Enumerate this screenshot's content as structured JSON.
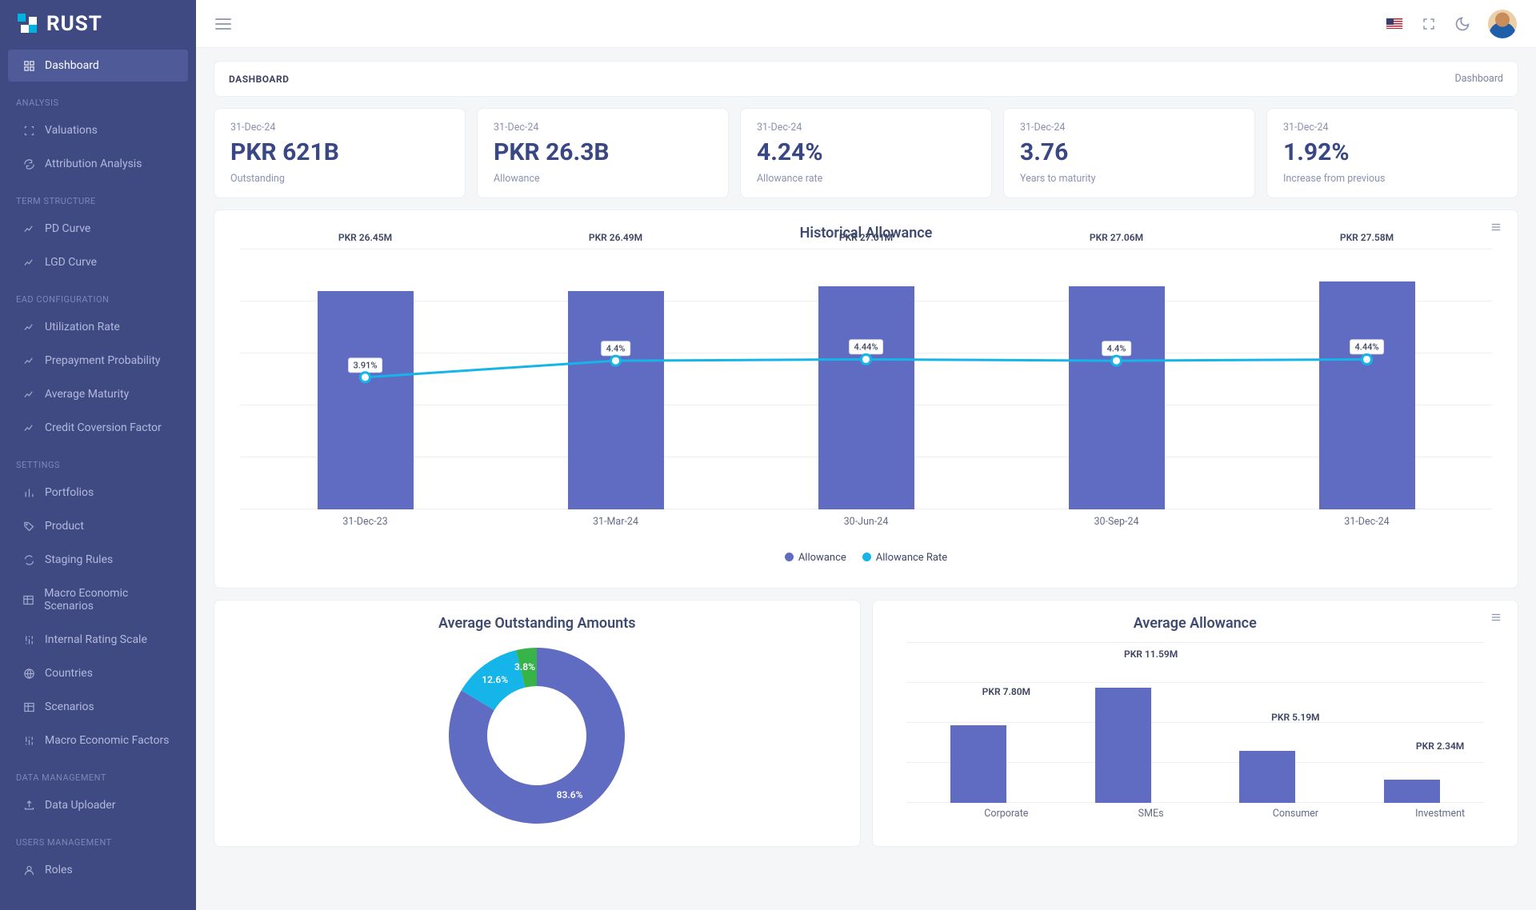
{
  "brand": "RUST",
  "sidebar": {
    "items": [
      {
        "label": "Dashboard",
        "icon": "grid",
        "active": true
      },
      {
        "heading": "ANALYSIS"
      },
      {
        "label": "Valuations",
        "icon": "scan"
      },
      {
        "label": "Attribution Analysis",
        "icon": "refresh"
      },
      {
        "heading": "TERM STRUCTURE"
      },
      {
        "label": "PD Curve",
        "icon": "line-chart"
      },
      {
        "label": "LGD Curve",
        "icon": "line-chart"
      },
      {
        "heading": "EAD CONFIGURATION"
      },
      {
        "label": "Utilization Rate",
        "icon": "line-chart"
      },
      {
        "label": "Prepayment Probability",
        "icon": "line-chart"
      },
      {
        "label": "Average Maturity",
        "icon": "line-chart"
      },
      {
        "label": "Credit Coversion Factor",
        "icon": "line-chart"
      },
      {
        "heading": "SETTINGS"
      },
      {
        "label": "Portfolios",
        "icon": "bars"
      },
      {
        "label": "Product",
        "icon": "tag"
      },
      {
        "label": "Staging Rules",
        "icon": "cycle"
      },
      {
        "label": "Macro Economic Scenarios",
        "icon": "table"
      },
      {
        "label": "Internal Rating Scale",
        "icon": "sliders"
      },
      {
        "label": "Countries",
        "icon": "globe"
      },
      {
        "label": "Scenarios",
        "icon": "table"
      },
      {
        "label": "Macro Economic Factors",
        "icon": "sliders"
      },
      {
        "heading": "DATA MANAGEMENT"
      },
      {
        "label": "Data Uploader",
        "icon": "upload"
      },
      {
        "heading": "USERS MANAGEMENT"
      },
      {
        "label": "Roles",
        "icon": "user"
      }
    ]
  },
  "page": {
    "title": "DASHBOARD",
    "breadcrumb": "Dashboard"
  },
  "cards": [
    {
      "date": "31-Dec-24",
      "value": "PKR 621B",
      "label": "Outstanding"
    },
    {
      "date": "31-Dec-24",
      "value": "PKR 26.3B",
      "label": "Allowance"
    },
    {
      "date": "31-Dec-24",
      "value": "4.24%",
      "label": "Allowance rate"
    },
    {
      "date": "31-Dec-24",
      "value": "3.76",
      "label": "Years to maturity"
    },
    {
      "date": "31-Dec-24",
      "value": "1.92%",
      "label": "Increase from previous"
    }
  ],
  "chart_data": [
    {
      "id": "historical_allowance",
      "type": "bar+line",
      "title": "Historical Allowance",
      "categories": [
        "31-Dec-23",
        "31-Mar-24",
        "30-Jun-24",
        "30-Sep-24",
        "31-Dec-24"
      ],
      "series": [
        {
          "name": "Allowance",
          "type": "bar",
          "color": "#606bc2",
          "labels": [
            "PKR 26.45M",
            "PKR 26.49M",
            "PKR 27.01M",
            "PKR 27.06M",
            "PKR 27.58M"
          ],
          "values": [
            26.45,
            26.49,
            27.01,
            27.06,
            27.58
          ]
        },
        {
          "name": "Allowance Rate",
          "type": "line",
          "color": "#15b5ea",
          "labels": [
            "3.91%",
            "4.4%",
            "4.44%",
            "4.4%",
            "4.44%"
          ],
          "values": [
            3.91,
            4.4,
            4.44,
            4.4,
            4.44
          ]
        }
      ],
      "legend": [
        "Allowance",
        "Allowance Rate"
      ]
    },
    {
      "id": "avg_outstanding",
      "type": "pie",
      "title": "Average Outstanding Amounts",
      "slices": [
        {
          "label": "83.6%",
          "value": 83.6,
          "color": "#606bc2"
        },
        {
          "label": "12.6%",
          "value": 12.6,
          "color": "#15b5ea"
        },
        {
          "label": "3.8%",
          "value": 3.8,
          "color": "#37b34a"
        }
      ]
    },
    {
      "id": "avg_allowance",
      "type": "bar",
      "title": "Average Allowance",
      "categories": [
        "Corporate",
        "SMEs",
        "Consumer",
        "Investment"
      ],
      "labels": [
        "PKR 7.80M",
        "PKR 11.59M",
        "PKR 5.19M",
        "PKR 2.34M"
      ],
      "values": [
        7.8,
        11.59,
        5.19,
        2.34
      ],
      "color": "#606bc2"
    }
  ]
}
